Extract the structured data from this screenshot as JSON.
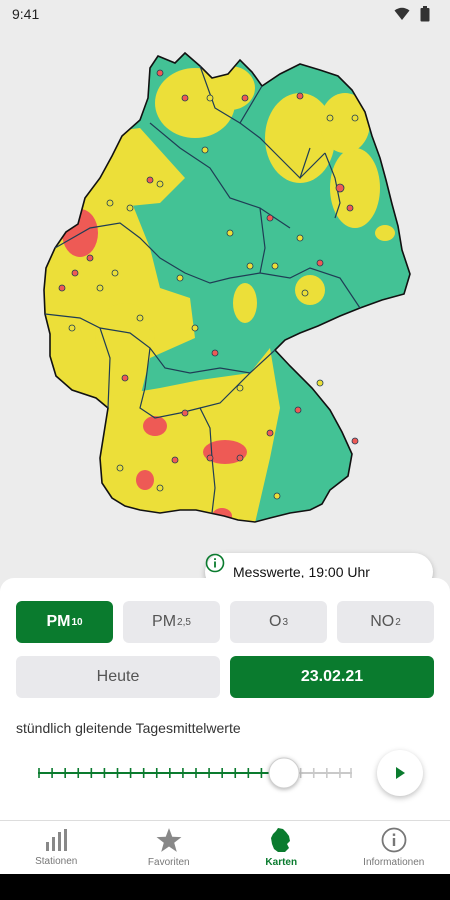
{
  "status_bar": {
    "time": "9:41",
    "wifi_icon": "wifi-icon",
    "battery_icon": "battery-icon"
  },
  "map": {
    "colors": {
      "good": "#43c295",
      "moderate": "#ecdf39",
      "poor": "#ee5a55",
      "background": "#ececec"
    }
  },
  "time_chip": {
    "label": "Messwerte, 19:00 Uhr",
    "icon": "info-icon"
  },
  "pollutants": [
    {
      "label": "PM",
      "sub": "10",
      "active": true
    },
    {
      "label": "PM",
      "sub": "2,5",
      "active": false
    },
    {
      "label": "O",
      "sub": "3",
      "active": false
    },
    {
      "label": "NO",
      "sub": "2",
      "active": false
    }
  ],
  "days": [
    {
      "label": "Heute",
      "active": false
    },
    {
      "label": "23.02.21",
      "active": true
    }
  ],
  "hint": "stündlich gleitende Tagesmittelwerte",
  "slider": {
    "steps": 24,
    "position": 19,
    "accent": "#0a7b2e"
  },
  "play_icon": "play-icon",
  "nav": [
    {
      "label": "Stationen",
      "icon": "bar-chart-icon",
      "active": false
    },
    {
      "label": "Favoriten",
      "icon": "star-icon",
      "active": false
    },
    {
      "label": "Karten",
      "icon": "germany-map-icon",
      "active": true
    },
    {
      "label": "Informationen",
      "icon": "info-icon",
      "active": false
    }
  ]
}
